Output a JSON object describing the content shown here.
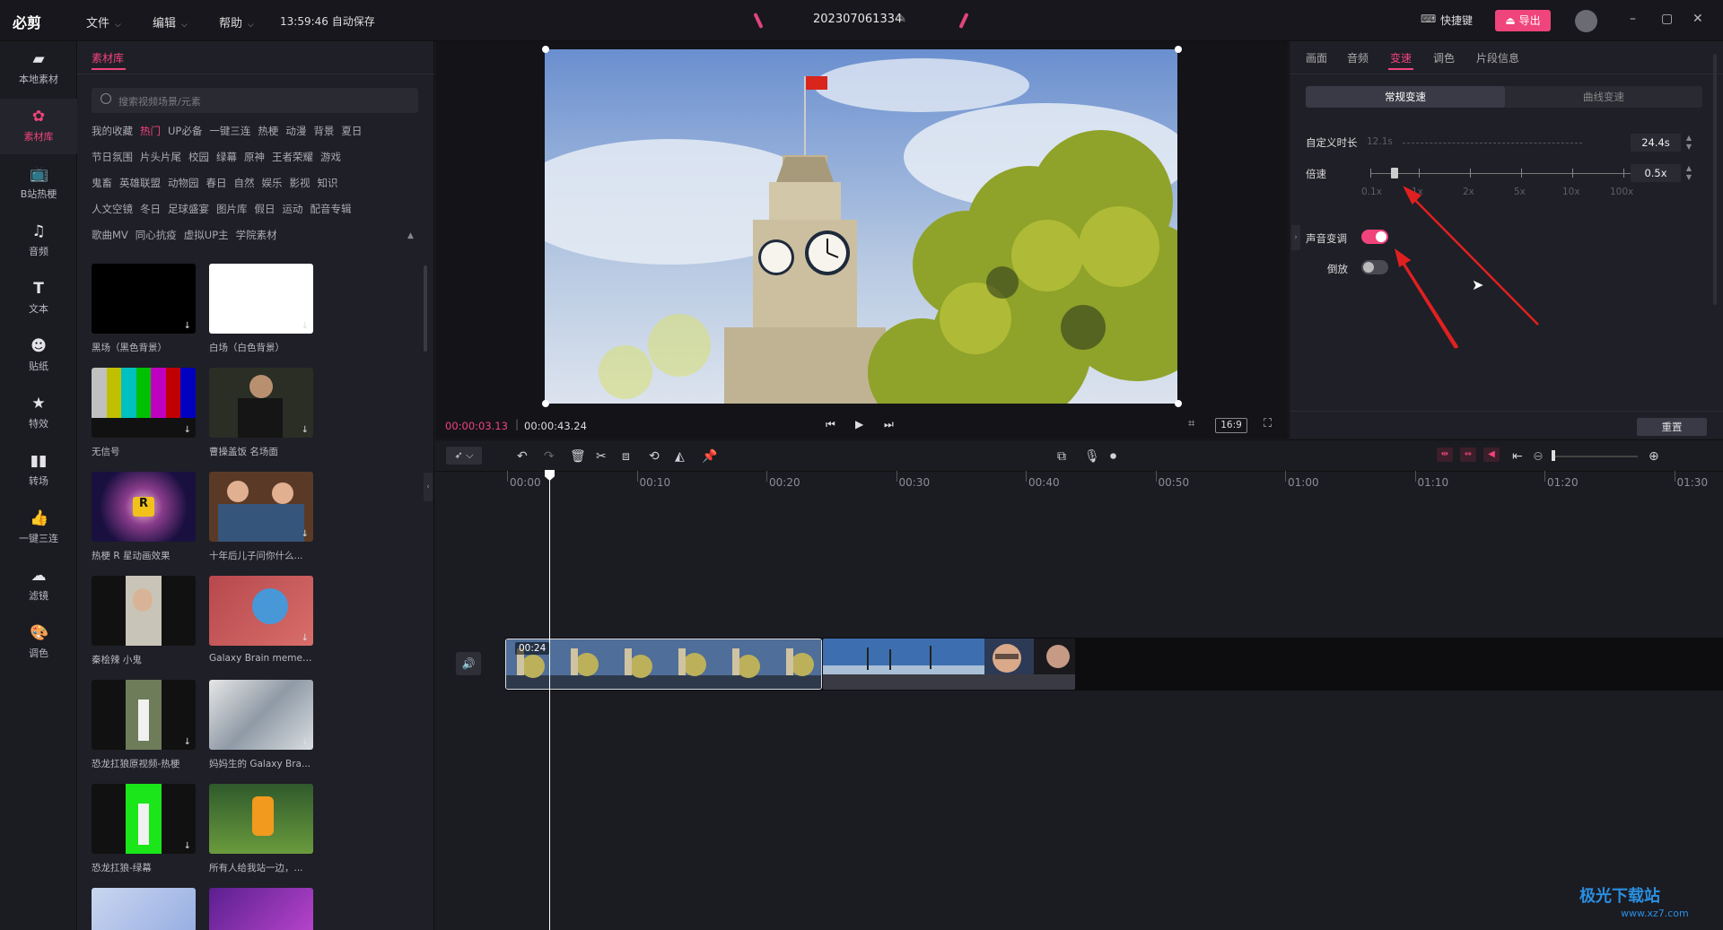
{
  "app": {
    "name": "必剪",
    "autosave": "13:59:46 自动保存",
    "project": "202307061334"
  },
  "menus": [
    "文件",
    "编辑",
    "帮助"
  ],
  "topbar": {
    "shortcut_label": "快捷键",
    "export_label": "导出"
  },
  "window_controls": [
    "–",
    "▢",
    "✕"
  ],
  "rail": [
    {
      "label": "本地素材",
      "icon": "folder-icon"
    },
    {
      "label": "素材库",
      "icon": "library-icon",
      "active": true
    },
    {
      "label": "B站热梗",
      "icon": "bilibili-icon"
    },
    {
      "label": "音频",
      "icon": "music-note-icon"
    },
    {
      "label": "文本",
      "icon": "text-icon"
    },
    {
      "label": "贴纸",
      "icon": "sticker-icon"
    },
    {
      "label": "特效",
      "icon": "effect-star-icon"
    },
    {
      "label": "转场",
      "icon": "transition-icon"
    },
    {
      "label": "一键三连",
      "icon": "thumbs-up-icon"
    },
    {
      "label": "滤镜",
      "icon": "filter-icon"
    },
    {
      "label": "调色",
      "icon": "palette-icon"
    }
  ],
  "library": {
    "tab": "素材库",
    "search_placeholder": "搜索视频场景/元素",
    "tags": [
      [
        "我的收藏",
        "热门",
        "UP必备",
        "一键三连",
        "热梗",
        "动漫",
        "背景",
        "夏日"
      ],
      [
        "节日氛围",
        "片头片尾",
        "校园",
        "绿幕",
        "原神",
        "王者荣耀",
        "游戏"
      ],
      [
        "鬼畜",
        "英雄联盟",
        "动物园",
        "春日",
        "自然",
        "娱乐",
        "影视",
        "知识"
      ],
      [
        "人文空镜",
        "冬日",
        "足球盛宴",
        "图片库",
        "假日",
        "运动",
        "配音专辑"
      ],
      [
        "歌曲MV",
        "同心抗疫",
        "虚拟UP主",
        "学院素材"
      ]
    ],
    "hot_tag": "热门",
    "cards": [
      {
        "caption": "黑场（黑色背景）",
        "style": "black"
      },
      {
        "caption": "白场（白色背景）",
        "style": "white"
      },
      {
        "caption": "无信号",
        "style": "bars"
      },
      {
        "caption": "曹操盖饭 名场面",
        "style": "dark-scene"
      },
      {
        "caption": "热梗 R 星动画效果",
        "style": "rstar"
      },
      {
        "caption": "十年后儿子问你什么...",
        "style": "people"
      },
      {
        "caption": "秦桧辣 小鬼",
        "style": "portrait"
      },
      {
        "caption": "Galaxy Brain meme ...",
        "style": "galaxy"
      },
      {
        "caption": "恐龙扛狼原视频-热梗",
        "style": "dance"
      },
      {
        "caption": "妈妈生的 Galaxy Bra...",
        "style": "silver"
      },
      {
        "caption": "恐龙扛狼-绿幕",
        "style": "greenscreen"
      },
      {
        "caption": "所有人给我站一边，...",
        "style": "cartoon"
      },
      {
        "caption": "",
        "style": "partial-light"
      },
      {
        "caption": "",
        "style": "partial-purple"
      }
    ]
  },
  "preview": {
    "current_time": "00:00:03.13",
    "duration": "00:00:43.24",
    "ratio": "16:9"
  },
  "props": {
    "tabs": [
      "画面",
      "音频",
      "变速",
      "调色",
      "片段信息"
    ],
    "active_tab": "变速",
    "modes": {
      "on": "常规变速",
      "off": "曲线变速"
    },
    "custom_duration_label": "自定义时长",
    "custom_duration_hint": "12.1s",
    "custom_duration_value": "24.4s",
    "speed_label": "倍速",
    "speed_value": "0.5x",
    "speed_marks": [
      "0.1x",
      "1x",
      "2x",
      "5x",
      "10x",
      "100x"
    ],
    "pitch_label": "声音变调",
    "pitch_on": true,
    "reverse_label": "倒放",
    "reverse_on": false,
    "reset_label": "重置",
    "accent": "#f0447c"
  },
  "timeline": {
    "ticks": [
      "00:00",
      "00:10",
      "00:20",
      "00:30",
      "00:40",
      "00:50",
      "01:00",
      "01:10",
      "01:20",
      "01:30"
    ],
    "clip_label": "00:24"
  },
  "watermark": {
    "title": "极光下载站",
    "url": "www.xz7.com"
  }
}
